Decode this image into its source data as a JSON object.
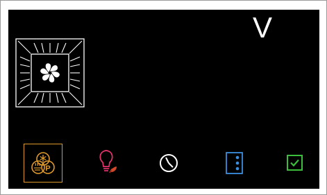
{
  "display": {
    "mode_letter": "V"
  },
  "icons": {
    "oven_fan": "oven-fan-icon",
    "functions": "functions-selector-icon",
    "light": "oven-light-icon",
    "timer": "clock-icon",
    "options": "more-options-icon",
    "confirm": "checkmark-icon"
  },
  "colors": {
    "screen_background": "#000000",
    "functions_accent": "#e09a2a",
    "light_accent": "#e8336d",
    "light_leaf": "#d4472a",
    "timer_accent": "#ffffff",
    "options_accent": "#3a8fe0",
    "confirm_accent": "#3bbf3b",
    "oven_outline": "#ffffff"
  }
}
